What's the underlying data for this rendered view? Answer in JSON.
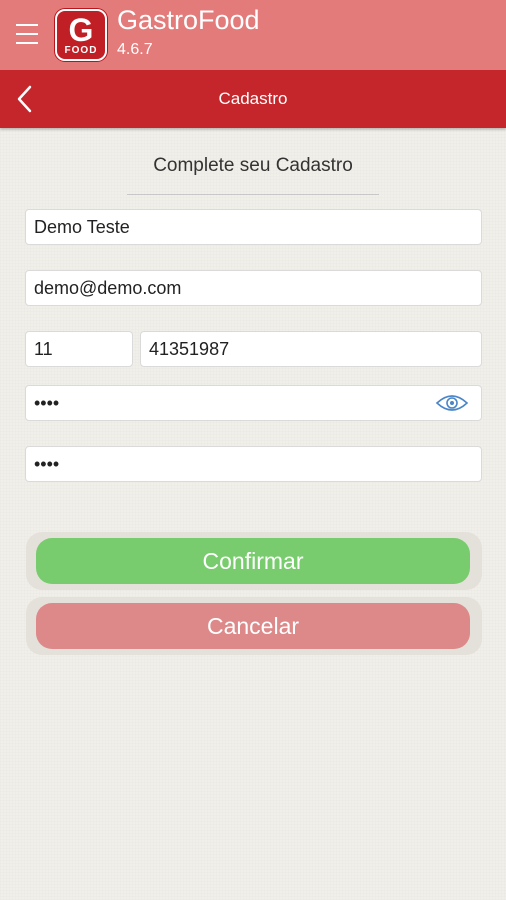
{
  "header": {
    "app_name": "GastroFood",
    "version": "4.6.7",
    "logo_letter": "G",
    "logo_word": "FOOD",
    "color": "#e37b7b"
  },
  "navbar": {
    "title": "Cadastro",
    "color": "#c4262b"
  },
  "form": {
    "title": "Complete seu Cadastro",
    "name_value": "Demo Teste",
    "email_value": "demo@demo.com",
    "area_code_value": "11",
    "phone_value": "41351987",
    "password_value": "••••",
    "confirm_password_value": "••••"
  },
  "buttons": {
    "confirm_label": "Confirmar",
    "cancel_label": "Cancelar",
    "confirm_color": "#78cc6e",
    "cancel_color": "#de8989"
  },
  "icons": {
    "menu": "hamburger-menu-icon",
    "back": "chevron-left-icon",
    "eye": "eye-icon"
  }
}
